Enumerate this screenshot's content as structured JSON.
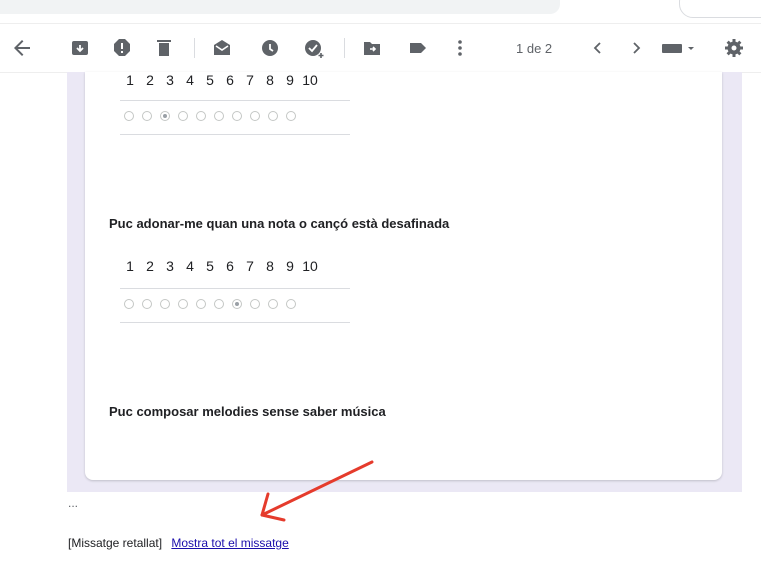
{
  "toolbar": {
    "icons": [
      {
        "name": "back-arrow-icon"
      },
      {
        "name": "archive-icon"
      },
      {
        "name": "report-spam-icon"
      },
      {
        "name": "delete-icon"
      },
      {
        "name": "mark-unread-icon"
      },
      {
        "name": "snooze-icon"
      },
      {
        "name": "add-to-tasks-icon"
      },
      {
        "name": "move-to-icon"
      },
      {
        "name": "label-icon"
      },
      {
        "name": "more-vert-icon"
      },
      {
        "name": "chevron-left-icon"
      },
      {
        "name": "chevron-right-icon"
      },
      {
        "name": "keyboard-icon"
      },
      {
        "name": "settings-gear-icon"
      }
    ],
    "pager_text": "1 de 2"
  },
  "form": {
    "scale_numbers": [
      "1",
      "2",
      "3",
      "4",
      "5",
      "6",
      "7",
      "8",
      "9",
      "10"
    ],
    "questions": [
      {
        "text": "",
        "selected": 3
      },
      {
        "text": "Puc adonar-me quan una nota o cançó està desafinada",
        "selected": 7
      },
      {
        "text": "Puc composar melodies sense saber música"
      }
    ]
  },
  "footer": {
    "ellipsis": "...",
    "clipped_label": "[Missatge retallat]",
    "show_all_link": "Mostra tot el missatge"
  },
  "colors": {
    "frame_bg": "#ebe8f5",
    "link": "#1a0dab",
    "annotation_arrow": "#e53b2c"
  }
}
